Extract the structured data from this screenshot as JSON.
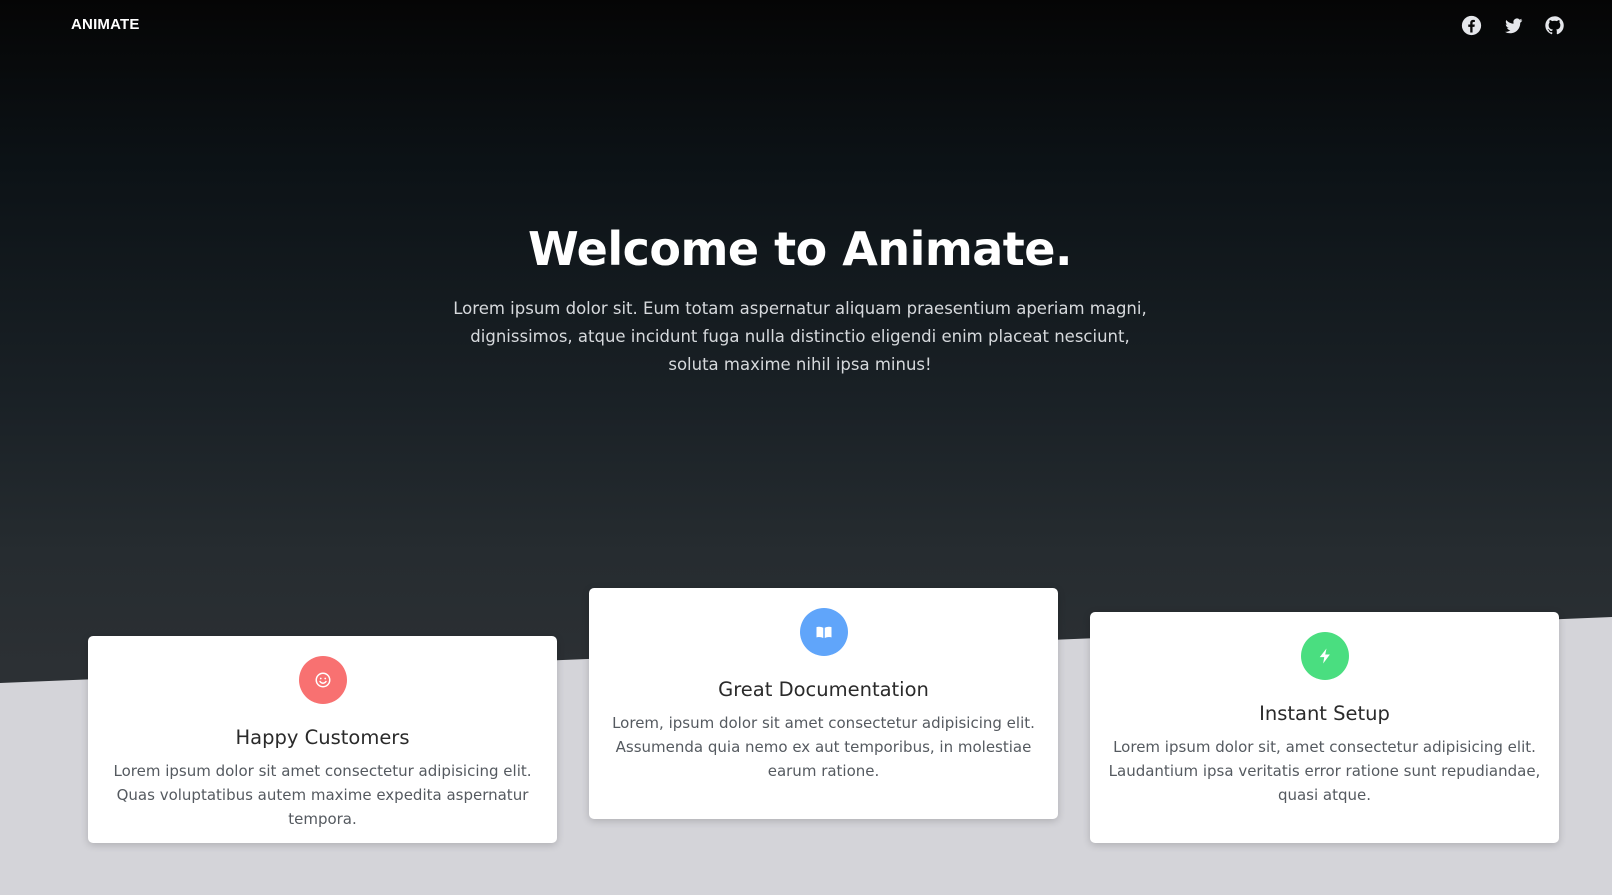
{
  "brand": "ANIMATE",
  "social": [
    {
      "name": "facebook-icon"
    },
    {
      "name": "twitter-icon"
    },
    {
      "name": "github-icon"
    }
  ],
  "hero": {
    "title": "Welcome to Animate.",
    "text": "Lorem ipsum dolor sit. Eum totam aspernatur aliquam praesentium aperiam magni, dignissimos, atque incidunt fuga nulla distinctio eligendi enim placeat nesciunt, soluta maxime nihil ipsa minus!"
  },
  "features": [
    {
      "title": "Happy Customers",
      "text": "Lorem ipsum dolor sit amet consectetur adipisicing elit. Quas voluptatibus autem maxime expedita aspernatur tempora.",
      "icon": "smile-icon",
      "color": "#f87171"
    },
    {
      "title": "Great Documentation",
      "text": "Lorem, ipsum dolor sit amet consectetur adipisicing elit. Assumenda quia nemo ex aut temporibus, in molestiae earum ratione.",
      "icon": "book-icon",
      "color": "#60a5fa"
    },
    {
      "title": "Instant Setup",
      "text": "Lorem ipsum dolor sit, amet consectetur adipisicing elit. Laudantium ipsa veritatis error ratione sunt repudiandae, quasi atque.",
      "icon": "lightning-icon",
      "color": "#4ade80"
    }
  ],
  "colors": {
    "background_light": "#d4d4d9",
    "hero_dark": "#050505",
    "card_bg": "#ffffff"
  }
}
